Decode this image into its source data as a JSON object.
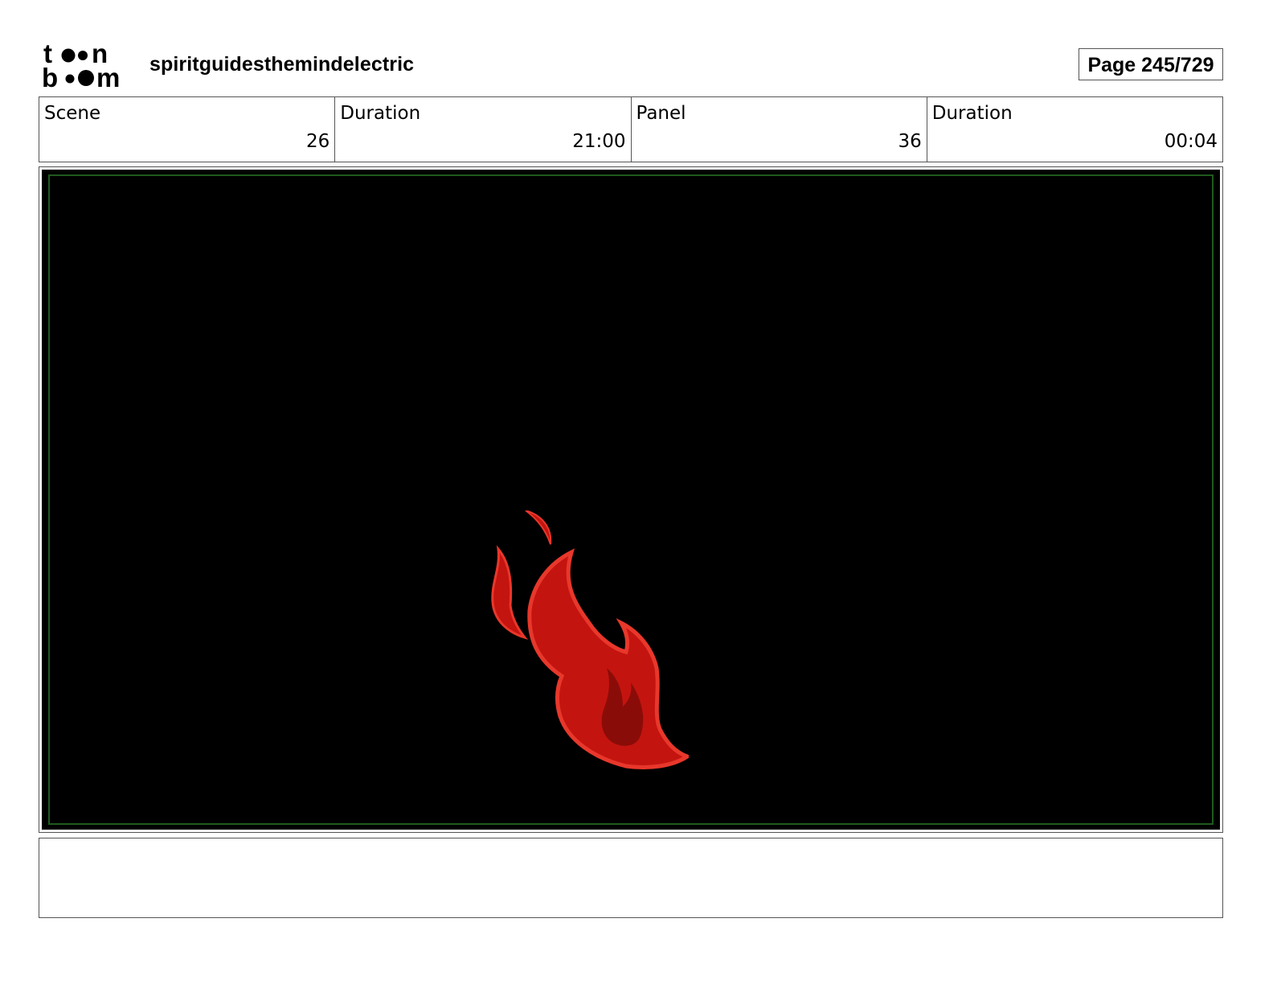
{
  "header": {
    "logo_text": "toon boom",
    "project_title": "spiritguidesthemindelectric",
    "page_indicator": "Page 245/729"
  },
  "info": {
    "scene_label": "Scene",
    "scene_value": "26",
    "scene_duration_label": "Duration",
    "scene_duration_value": "21:00",
    "panel_label": "Panel",
    "panel_value": "36",
    "panel_duration_label": "Duration",
    "panel_duration_value": "00:04"
  },
  "panel": {
    "background_color": "#000000",
    "safe_frame_color": "#1f5a1f",
    "flame_colors": {
      "outer": "#e8372b",
      "body": "#c4140f",
      "core": "#8a0c08"
    }
  },
  "notes": {
    "text": ""
  }
}
